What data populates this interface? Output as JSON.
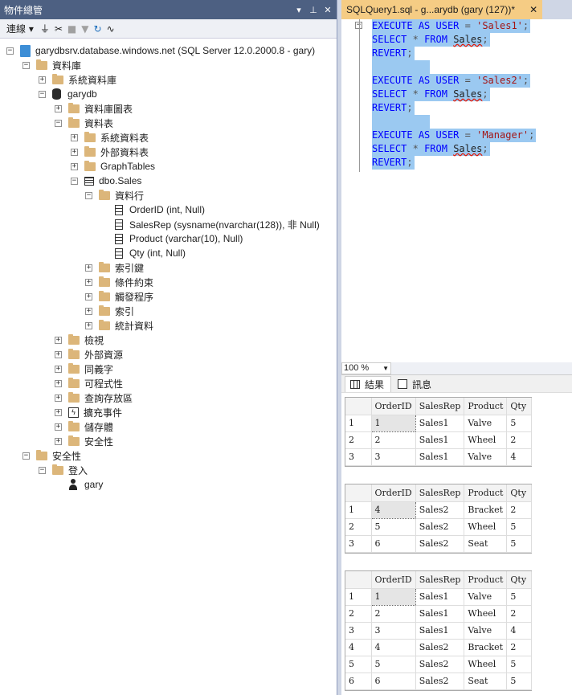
{
  "object_explorer": {
    "title": "物件總管",
    "title_buttons": [
      "▾",
      "⊥",
      "✕"
    ],
    "toolbar": {
      "connect_label": "連線 ▾"
    },
    "tree": [
      {
        "label": "garydbsrv.database.windows.net (SQL Server 12.0.2000.8 - gary)",
        "icon": "server-icon",
        "expander": "minus"
      },
      {
        "label": "資料庫",
        "icon": "folder-icon",
        "expander": "minus"
      },
      {
        "label": "系統資料庫",
        "icon": "folder-icon",
        "expander": "plus"
      },
      {
        "label": "garydb",
        "icon": "database-icon",
        "expander": "minus"
      },
      {
        "label": "資料庫圖表",
        "icon": "folder-icon",
        "expander": "plus"
      },
      {
        "label": "資料表",
        "icon": "folder-icon",
        "expander": "minus"
      },
      {
        "label": "系統資料表",
        "icon": "folder-icon",
        "expander": "plus"
      },
      {
        "label": "外部資料表",
        "icon": "folder-icon",
        "expander": "plus"
      },
      {
        "label": "GraphTables",
        "icon": "folder-icon",
        "expander": "plus"
      },
      {
        "label": "dbo.Sales",
        "icon": "table-icon",
        "expander": "minus"
      },
      {
        "label": "資料行",
        "icon": "folder-icon",
        "expander": "minus"
      },
      {
        "label": "OrderID (int, Null)",
        "icon": "column-icon",
        "expander": "none"
      },
      {
        "label": "SalesRep (sysname(nvarchar(128)), 非 Null)",
        "icon": "column-icon",
        "expander": "none"
      },
      {
        "label": "Product (varchar(10), Null)",
        "icon": "column-icon",
        "expander": "none"
      },
      {
        "label": "Qty (int, Null)",
        "icon": "column-icon",
        "expander": "none"
      },
      {
        "label": "索引鍵",
        "icon": "folder-icon",
        "expander": "plus"
      },
      {
        "label": "條件約束",
        "icon": "folder-icon",
        "expander": "plus"
      },
      {
        "label": "觸發程序",
        "icon": "folder-icon",
        "expander": "plus"
      },
      {
        "label": "索引",
        "icon": "folder-icon",
        "expander": "plus"
      },
      {
        "label": "統計資料",
        "icon": "folder-icon",
        "expander": "plus"
      },
      {
        "label": "檢視",
        "icon": "folder-icon",
        "expander": "plus"
      },
      {
        "label": "外部資源",
        "icon": "folder-icon",
        "expander": "plus"
      },
      {
        "label": "同義字",
        "icon": "folder-icon",
        "expander": "plus"
      },
      {
        "label": "可程式性",
        "icon": "folder-icon",
        "expander": "plus"
      },
      {
        "label": "查詢存放區",
        "icon": "folder-icon",
        "expander": "plus"
      },
      {
        "label": "擴充事件",
        "icon": "extended-events-icon",
        "expander": "plus"
      },
      {
        "label": "儲存體",
        "icon": "folder-icon",
        "expander": "plus"
      },
      {
        "label": "安全性",
        "icon": "folder-icon",
        "expander": "plus"
      },
      {
        "label": "安全性",
        "icon": "folder-icon",
        "expander": "minus"
      },
      {
        "label": "登入",
        "icon": "folder-icon",
        "expander": "minus"
      },
      {
        "label": "gary",
        "icon": "user-icon",
        "expander": "none"
      }
    ]
  },
  "editor": {
    "tab_label": "SQLQuery1.sql - g...arydb (gary (127))*",
    "tab_close": "✕",
    "lines": [
      {
        "kw1": "EXECUTE",
        "kw2": "AS",
        "kw3": "USER",
        "op": "=",
        "str": "'Sales1'",
        "end": ";"
      },
      {
        "select": "SELECT",
        "star": "*",
        "from": "FROM",
        "table": "Sales",
        "end": ";"
      },
      {
        "revert": "REVERT",
        "end": ";"
      },
      {
        "kw1": "EXECUTE",
        "kw2": "AS",
        "kw3": "USER",
        "op": "=",
        "str": "'Sales2'",
        "end": ";"
      },
      {
        "select": "SELECT",
        "star": "*",
        "from": "FROM",
        "table": "Sales",
        "end": ";"
      },
      {
        "revert": "REVERT",
        "end": ";"
      },
      {
        "kw1": "EXECUTE",
        "kw2": "AS",
        "kw3": "USER",
        "op": "=",
        "str": "'Manager'",
        "end": ";"
      },
      {
        "select": "SELECT",
        "star": "*",
        "from": "FROM",
        "table": "Sales",
        "end": ";"
      },
      {
        "revert": "REVERT",
        "end": ";"
      }
    ]
  },
  "results": {
    "zoom": "100 %",
    "tabs": [
      "結果",
      "訊息"
    ],
    "columns": [
      "OrderID",
      "SalesRep",
      "Product",
      "Qty"
    ],
    "grids": [
      {
        "rows": [
          [
            "1",
            "1",
            "Sales1",
            "Valve",
            "5"
          ],
          [
            "2",
            "2",
            "Sales1",
            "Wheel",
            "2"
          ],
          [
            "3",
            "3",
            "Sales1",
            "Valve",
            "4"
          ]
        ]
      },
      {
        "rows": [
          [
            "1",
            "4",
            "Sales2",
            "Bracket",
            "2"
          ],
          [
            "2",
            "5",
            "Sales2",
            "Wheel",
            "5"
          ],
          [
            "3",
            "6",
            "Sales2",
            "Seat",
            "5"
          ]
        ]
      },
      {
        "rows": [
          [
            "1",
            "1",
            "Sales1",
            "Valve",
            "5"
          ],
          [
            "2",
            "2",
            "Sales1",
            "Wheel",
            "2"
          ],
          [
            "3",
            "3",
            "Sales1",
            "Valve",
            "4"
          ],
          [
            "4",
            "4",
            "Sales2",
            "Bracket",
            "2"
          ],
          [
            "5",
            "5",
            "Sales2",
            "Wheel",
            "5"
          ],
          [
            "6",
            "6",
            "Sales2",
            "Seat",
            "5"
          ]
        ]
      }
    ]
  },
  "colors": {
    "title_bar": "#4d6082",
    "tab_active": "#f5cc84",
    "selection": "#9bc9f1",
    "keyword": "#0000ff",
    "string": "#a31515"
  }
}
